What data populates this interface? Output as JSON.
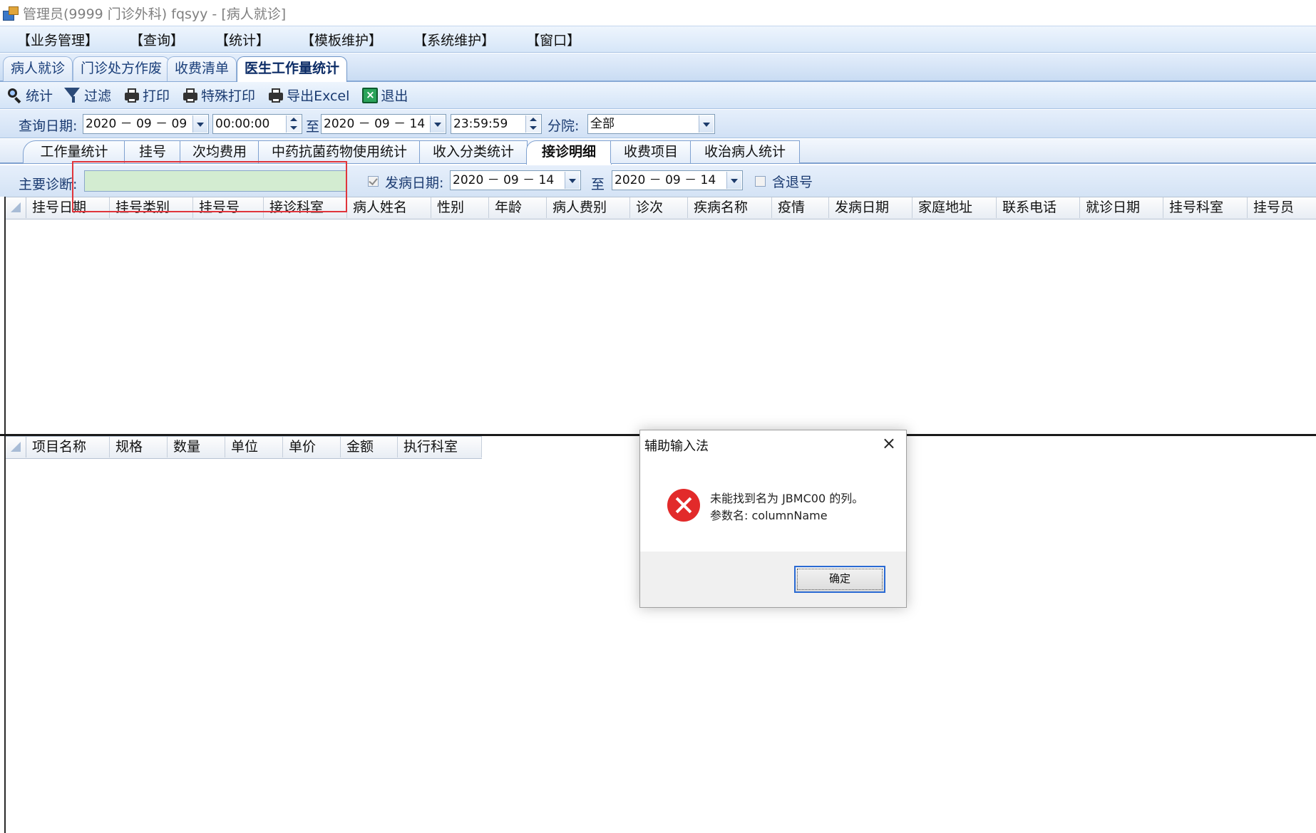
{
  "window": {
    "title": "管理员(9999 门诊外科) fqsyy - [病人就诊]"
  },
  "menu": [
    "【业务管理】",
    "【查询】",
    "【统计】",
    "【模板维护】",
    "【系统维护】",
    "【窗口】"
  ],
  "module_tabs": [
    "病人就诊",
    "门诊处方作废",
    "收费清单",
    "医生工作量统计"
  ],
  "module_tabs_active": "医生工作量统计",
  "toolbar": {
    "stats": "统计",
    "filter": "过滤",
    "print": "打印",
    "special_print": "特殊打印",
    "export": "导出Excel",
    "exit": "退出"
  },
  "query": {
    "date_label": "查询日期:",
    "date_from": "2020 － 09 － 09",
    "time_from": "00:00:00",
    "to": "至",
    "date_to": "2020 － 09 － 14",
    "time_to": "23:59:59",
    "branch_label": "分院:",
    "branch_value": "全部"
  },
  "report_tabs": [
    "工作量统计",
    "挂号",
    "次均费用",
    "中药抗菌药物使用统计",
    "收入分类统计",
    "接诊明细",
    "收费项目",
    "收治病人统计"
  ],
  "report_tabs_active": "接诊明细",
  "filter": {
    "diagnosis_label": "主要诊断:",
    "diagnosis_value": "",
    "onset_checked": true,
    "onset_label": "发病日期:",
    "onset_from": "2020 － 09 － 14",
    "to": "至",
    "onset_to": "2020 － 09 － 14",
    "refund_checked": false,
    "refund_label": "含退号"
  },
  "main_grid": {
    "columns": [
      "挂号日期",
      "挂号类别",
      "挂号号",
      "接诊科室",
      "病人姓名",
      "性别",
      "年龄",
      "病人费别",
      "诊次",
      "疾病名称",
      "疫情",
      "发病日期",
      "家庭地址",
      "联系电话",
      "就诊日期",
      "挂号科室",
      "挂号员"
    ],
    "rows": []
  },
  "detail_grid": {
    "columns": [
      "项目名称",
      "规格",
      "数量",
      "单位",
      "单价",
      "金额",
      "执行科室"
    ],
    "rows": []
  },
  "dialog": {
    "title": "辅助输入法",
    "close": "×",
    "message_line1": "未能找到名为 JBMC00 的列。",
    "message_line2": "参数名: columnName",
    "ok": "确定"
  },
  "colors": {
    "highlight_box": "#e0353b",
    "error_icon": "#e22a2a",
    "diagnosis_field_bg": "#d3ecd1"
  }
}
